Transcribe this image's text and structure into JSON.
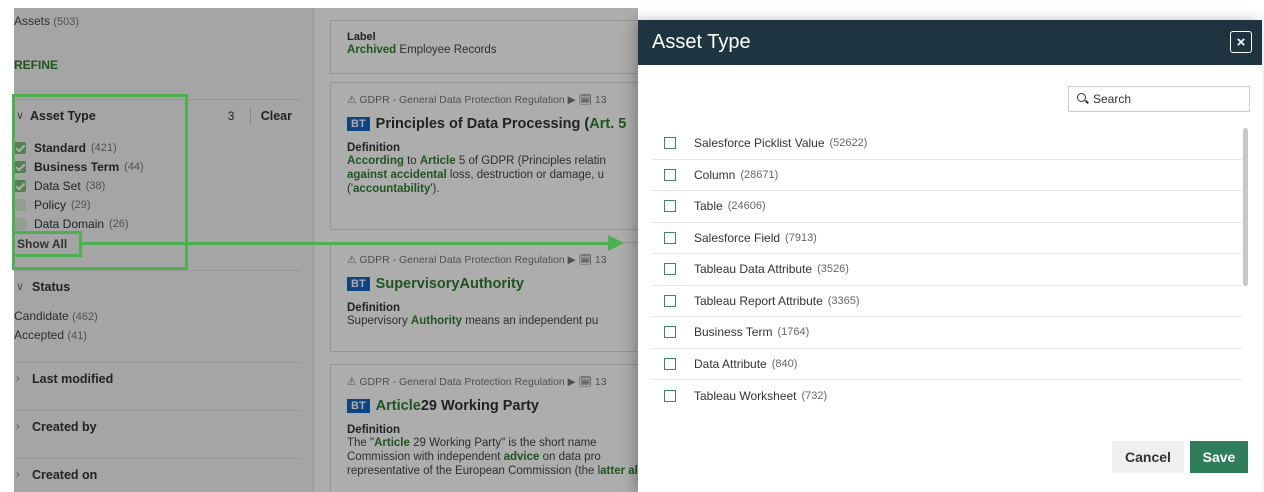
{
  "sidebar": {
    "assets_label": "Assets",
    "assets_count": "(503)",
    "refine_label": "REFINE",
    "asset_type": {
      "title": "Asset Type",
      "selected_count": "3",
      "clear_label": "Clear",
      "options": [
        {
          "label": "Standard",
          "count": "(421)",
          "checked": true
        },
        {
          "label": "Business Term",
          "count": "(44)",
          "checked": true
        },
        {
          "label": "Data Set",
          "count": "(38)",
          "checked": true
        },
        {
          "label": "Policy",
          "count": "(29)",
          "checked": false
        },
        {
          "label": "Data Domain",
          "count": "(26)",
          "checked": false
        }
      ],
      "show_all_label": "Show All"
    },
    "status": {
      "title": "Status",
      "options": [
        {
          "label": "Candidate",
          "count": "(462)"
        },
        {
          "label": "Accepted",
          "count": "(41)"
        }
      ]
    },
    "last_modified_label": "Last modified",
    "created_by_label": "Created by",
    "created_on_label": "Created on"
  },
  "results": {
    "card1": {
      "label_heading": "Label",
      "value_bold": "Archived",
      "value_rest": " Employee Records"
    },
    "card2": {
      "crumb": "⚠ GDPR - General Data Protection Regulation ▶ 🗓 13",
      "badge": "BT",
      "title_a": "Principles of Data Processing (",
      "title_b": "Art. 5",
      "definition_label": "Definition",
      "line1_a": "According",
      "line1_b": " to ",
      "line1_c": "Article",
      "line1_d": " 5 of GDPR (Principles relatin",
      "line2_a": "against accidental",
      "line2_b": " loss, destruction or damage, u",
      "line3_a": "('",
      "line3_b": "accountability",
      "line3_c": "')."
    },
    "card3": {
      "crumb": "⚠ GDPR - General Data Protection Regulation ▶ 🗓 13",
      "badge": "BT",
      "title_a": "Supervisory ",
      "title_b": "Authority",
      "definition_label": "Definition",
      "line1_a": "Supervisory ",
      "line1_b": "Authority",
      "line1_c": " means an independent pu"
    },
    "card4": {
      "crumb": "⚠ GDPR - General Data Protection Regulation ▶ 🗓 13",
      "badge": "BT",
      "title_a": "Article",
      "title_b": " 29 Working Party",
      "definition_label": "Definition",
      "line1_a": "The \"",
      "line1_b": "Article",
      "line1_c": " 29 Working Party\" is the short name",
      "line2_a": "Commission with independent ",
      "line2_b": "advice",
      "line2_c": " on data pro",
      "line3_a": "representative of the European Commission (the l",
      "line3_b": "atter also"
    }
  },
  "modal": {
    "title": "Asset Type",
    "close_symbol": "×",
    "search_placeholder": "Search",
    "items": [
      {
        "label": "Salesforce Picklist Value",
        "count": "(52622)"
      },
      {
        "label": "Column",
        "count": "(28671)"
      },
      {
        "label": "Table",
        "count": "(24606)"
      },
      {
        "label": "Salesforce Field",
        "count": "(7913)"
      },
      {
        "label": "Tableau Data Attribute",
        "count": "(3526)"
      },
      {
        "label": "Tableau Report Attribute",
        "count": "(3365)"
      },
      {
        "label": "Business Term",
        "count": "(1764)"
      },
      {
        "label": "Data Attribute",
        "count": "(840)"
      },
      {
        "label": "Tableau Worksheet",
        "count": "(732)"
      }
    ],
    "cancel_label": "Cancel",
    "save_label": "Save"
  }
}
